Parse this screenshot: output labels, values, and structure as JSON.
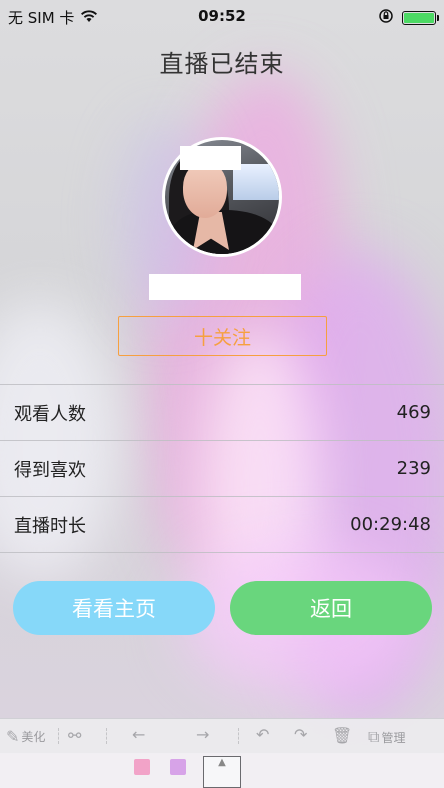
{
  "status_bar": {
    "carrier": "无 SIM 卡",
    "time": "09:52",
    "icons": [
      "wifi-icon",
      "rotation-lock-icon",
      "battery-icon"
    ],
    "battery_level": 1.0,
    "battery_color": "#4cd964"
  },
  "header": {
    "title": "直播已结束"
  },
  "follow_button": {
    "icon": "plus-icon",
    "label": "十关注",
    "color": "#f6a040"
  },
  "stats": [
    {
      "label": "观看人数",
      "value": "469"
    },
    {
      "label": "得到喜欢",
      "value": "239"
    },
    {
      "label": "直播时长",
      "value": "00:29:48"
    }
  ],
  "actions": {
    "profile_label": "看看主页",
    "profile_color": "#86d8f9",
    "back_label": "返回",
    "back_color": "#69d67d"
  },
  "toolbar": {
    "items": [
      {
        "icon": "pencil-icon",
        "label": "美化"
      },
      {
        "icon": "share-icon",
        "label": ""
      },
      {
        "icon": "arrow-left-icon",
        "label": ""
      },
      {
        "icon": "arrow-right-icon",
        "label": ""
      },
      {
        "icon": "undo-icon",
        "label": ""
      },
      {
        "icon": "redo-icon",
        "label": ""
      },
      {
        "icon": "trash-icon",
        "label": ""
      },
      {
        "icon": "copy-icon",
        "label": "管理"
      }
    ]
  }
}
